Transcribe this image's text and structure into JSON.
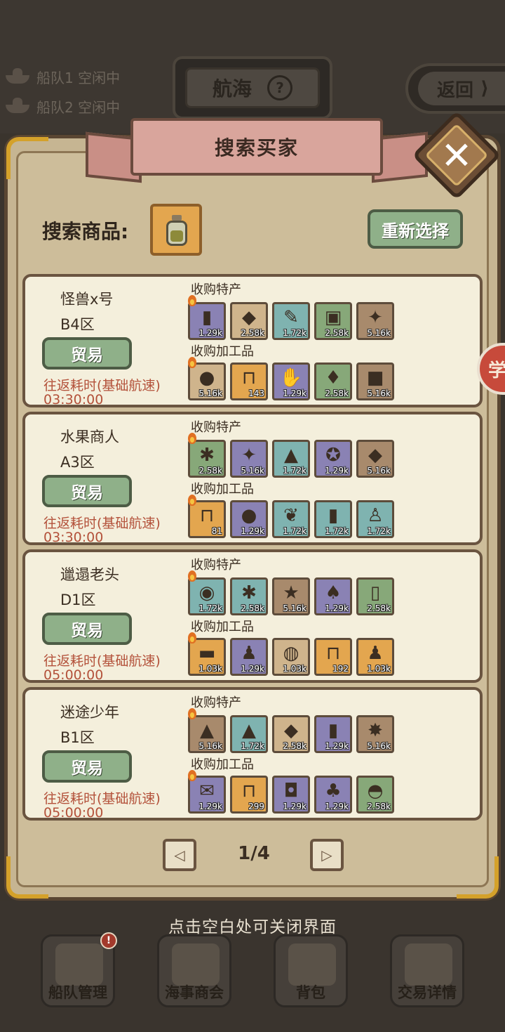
{
  "background": {
    "fleet_status": [
      {
        "label": "船队1 空闲中"
      },
      {
        "label": "船队2 空闲中"
      }
    ],
    "sail_button_label": "航海",
    "help_icon_glyph": "?",
    "return_button_label": "返回",
    "return_arrow_glyph": "⟩"
  },
  "dialog": {
    "title": "搜索买家",
    "close_glyph": "✕",
    "search_label": "搜索商品:",
    "reselect_label": "重新选择",
    "selected_item_icon": "jar-icon"
  },
  "section_labels": {
    "specialty": "收购特产",
    "processed": "收购加工品",
    "trade": "贸易",
    "trip": "往返耗时(基础航速)"
  },
  "buyers": [
    {
      "name": "怪兽x号",
      "zone": "B4区",
      "time": "03:30:00",
      "specialty": [
        {
          "icon": "emerald-icon",
          "glyph": "▮",
          "bg": "bg-purple",
          "qty": "1.29k"
        },
        {
          "icon": "gold-crystal-icon",
          "glyph": "◆",
          "bg": "bg-tan",
          "qty": "2.58k"
        },
        {
          "icon": "scroll-icon",
          "glyph": "✎",
          "bg": "bg-teal",
          "qty": "1.72k"
        },
        {
          "icon": "book-icon",
          "glyph": "▣",
          "bg": "bg-green",
          "qty": "2.58k"
        },
        {
          "icon": "spellbook-icon",
          "glyph": "✦",
          "bg": "bg-brown",
          "qty": "5.16k"
        }
      ],
      "processed": [
        {
          "icon": "cookie-icon",
          "glyph": "●",
          "bg": "bg-tan",
          "qty": "5.16k"
        },
        {
          "icon": "jar-icon",
          "glyph": "⊓",
          "bg": "bg-orange",
          "qty": "143"
        },
        {
          "icon": "glove-icon",
          "glyph": "✋",
          "bg": "bg-purple",
          "qty": "1.29k"
        },
        {
          "icon": "vase-icon",
          "glyph": "♦",
          "bg": "bg-green",
          "qty": "2.58k"
        },
        {
          "icon": "red-box-icon",
          "glyph": "■",
          "bg": "bg-brown",
          "qty": "5.16k"
        }
      ]
    },
    {
      "name": "水果商人",
      "zone": "A3区",
      "time": "03:30:00",
      "specialty": [
        {
          "icon": "coral-icon",
          "glyph": "✱",
          "bg": "bg-green",
          "qty": "2.58k"
        },
        {
          "icon": "spellbook-icon",
          "glyph": "✦",
          "bg": "bg-purple",
          "qty": "5.16k"
        },
        {
          "icon": "obsidian-icon",
          "glyph": "▲",
          "bg": "bg-teal",
          "qty": "1.72k"
        },
        {
          "icon": "coin-icon",
          "glyph": "✪",
          "bg": "bg-purple",
          "qty": "1.29k"
        },
        {
          "icon": "amethyst-icon",
          "glyph": "◆",
          "bg": "bg-brown",
          "qty": "5.16k"
        }
      ],
      "processed": [
        {
          "icon": "jar-icon",
          "glyph": "⊓",
          "bg": "bg-orange",
          "qty": "81"
        },
        {
          "icon": "mushroom-icon",
          "glyph": "●",
          "bg": "bg-purple",
          "qty": "1.29k"
        },
        {
          "icon": "leaf-icon",
          "glyph": "❦",
          "bg": "bg-teal",
          "qty": "1.72k"
        },
        {
          "icon": "can-icon",
          "glyph": "▮",
          "bg": "bg-teal",
          "qty": "1.72k"
        },
        {
          "icon": "shirt-icon",
          "glyph": "♙",
          "bg": "bg-teal",
          "qty": "1.72k"
        }
      ]
    },
    {
      "name": "邋遢老头",
      "zone": "D1区",
      "time": "05:00:00",
      "specialty": [
        {
          "icon": "shell-icon",
          "glyph": "◉",
          "bg": "bg-teal",
          "qty": "1.72k"
        },
        {
          "icon": "coral-icon",
          "glyph": "✱",
          "bg": "bg-teal",
          "qty": "2.58k"
        },
        {
          "icon": "starfish-icon",
          "glyph": "★",
          "bg": "bg-brown",
          "qty": "5.16k"
        },
        {
          "icon": "mushroom-icon",
          "glyph": "♠",
          "bg": "bg-purple",
          "qty": "1.29k"
        },
        {
          "icon": "bottle-icon",
          "glyph": "▯",
          "bg": "bg-green",
          "qty": "2.58k"
        }
      ],
      "processed": [
        {
          "icon": "cloth-icon",
          "glyph": "▬",
          "bg": "bg-orange",
          "qty": "1.03k"
        },
        {
          "icon": "perfume-icon",
          "glyph": "♟",
          "bg": "bg-purple",
          "qty": "1.29k"
        },
        {
          "icon": "pouch-icon",
          "glyph": "◍",
          "bg": "bg-tan",
          "qty": "1.03k"
        },
        {
          "icon": "jar-icon",
          "glyph": "⊓",
          "bg": "bg-orange",
          "qty": "192"
        },
        {
          "icon": "perfume-icon",
          "glyph": "♟",
          "bg": "bg-orange",
          "qty": "1.03k"
        }
      ]
    },
    {
      "name": "迷途少年",
      "zone": "B1区",
      "time": "05:00:00",
      "specialty": [
        {
          "icon": "powder-icon",
          "glyph": "▲",
          "bg": "bg-brown",
          "qty": "5.16k"
        },
        {
          "icon": "obsidian-icon",
          "glyph": "▲",
          "bg": "bg-teal",
          "qty": "1.72k"
        },
        {
          "icon": "gold-crystal-icon",
          "glyph": "◆",
          "bg": "bg-tan",
          "qty": "2.58k"
        },
        {
          "icon": "emerald-icon",
          "glyph": "▮",
          "bg": "bg-purple",
          "qty": "1.29k"
        },
        {
          "icon": "lava-rock-icon",
          "glyph": "✸",
          "bg": "bg-brown",
          "qty": "5.16k"
        }
      ],
      "processed": [
        {
          "icon": "map-icon",
          "glyph": "✉",
          "bg": "bg-purple",
          "qty": "1.29k"
        },
        {
          "icon": "jar-icon",
          "glyph": "⊓",
          "bg": "bg-orange",
          "qty": "299"
        },
        {
          "icon": "backpack-icon",
          "glyph": "◘",
          "bg": "bg-purple",
          "qty": "1.29k"
        },
        {
          "icon": "potion-icon",
          "glyph": "♣",
          "bg": "bg-purple",
          "qty": "1.29k"
        },
        {
          "icon": "pot-icon",
          "glyph": "◓",
          "bg": "bg-green",
          "qty": "2.58k"
        }
      ]
    }
  ],
  "pagination": {
    "current": "1/4",
    "prev_glyph": "◁",
    "next_glyph": "▷"
  },
  "side_tab_label": "学",
  "close_hint": "点击空白处可关闭界面",
  "nav": [
    {
      "name": "nav-fleet-management",
      "label": "船队管理",
      "badge": "!"
    },
    {
      "name": "nav-maritime-guild",
      "label": "海事商会"
    },
    {
      "name": "nav-backpack",
      "label": "背包"
    },
    {
      "name": "nav-trade-details",
      "label": "交易详情"
    }
  ]
}
